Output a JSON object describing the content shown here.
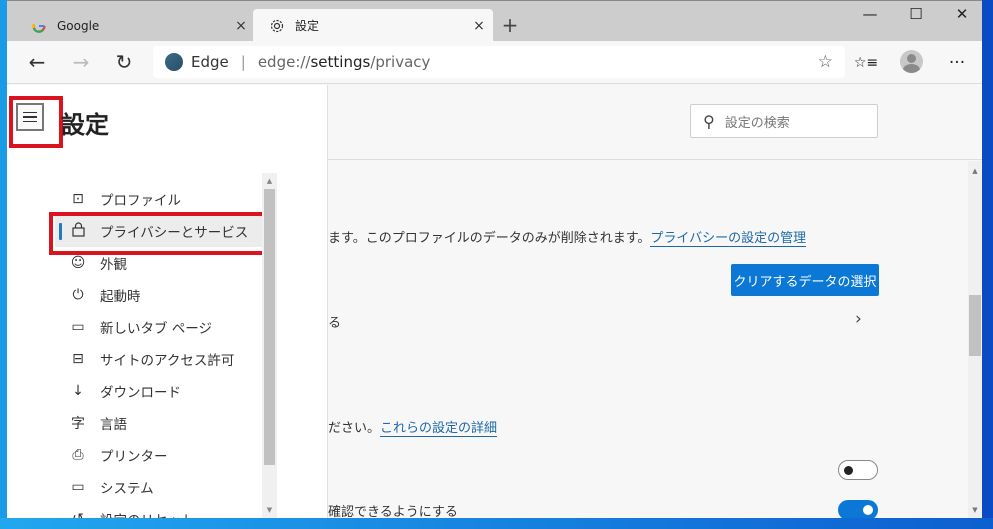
{
  "tabs": [
    {
      "title": "Google",
      "icon": "google-icon",
      "close": "×"
    },
    {
      "title": "設定",
      "icon": "gear-icon",
      "close": "×"
    }
  ],
  "new_tab": "+",
  "window_controls": {
    "minimize": "—",
    "maximize": "☐",
    "close": "✕"
  },
  "toolbar": {
    "back": "←",
    "forward": "→",
    "refresh": "↻",
    "address_brand": "Edge",
    "address_separator": "|",
    "url_prefix": "edge://",
    "url_host": "settings",
    "url_path": "/privacy",
    "favorite_star": "☆",
    "favorites": "☆≡",
    "more": "···"
  },
  "sidebar": {
    "title": "設定",
    "items": [
      {
        "label": "プロファイル",
        "icon": "⊡",
        "icon_name": "profile-icon"
      },
      {
        "label": "プライバシーとサービス",
        "icon": "🔒︎",
        "icon_name": "lock-icon",
        "selected": true
      },
      {
        "label": "外観",
        "icon": "☺",
        "icon_name": "palette-icon"
      },
      {
        "label": "起動時",
        "icon": "⏻",
        "icon_name": "power-icon"
      },
      {
        "label": "新しいタブ ページ",
        "icon": "▭",
        "icon_name": "new-tab-page-icon"
      },
      {
        "label": "サイトのアクセス許可",
        "icon": "⊟",
        "icon_name": "site-permissions-icon"
      },
      {
        "label": "ダウンロード",
        "icon": "↓",
        "icon_name": "download-icon"
      },
      {
        "label": "言語",
        "icon": "字",
        "icon_name": "language-icon"
      },
      {
        "label": "プリンター",
        "icon": "⎙",
        "icon_name": "printer-icon"
      },
      {
        "label": "システム",
        "icon": "▭",
        "icon_name": "laptop-icon"
      },
      {
        "label": "設定のリセット",
        "icon": "↺",
        "icon_name": "reset-icon"
      }
    ]
  },
  "search": {
    "placeholder": "設定の検索",
    "icon": "⚲"
  },
  "content": {
    "clear_data_text": "ます。このプロファイルのデータのみが削除されます。",
    "clear_data_link": "プライバシーの設定の管理",
    "clear_button": "クリアするデータの選択",
    "row_text": "る",
    "chevron": "›",
    "privacy_text": "ださい。",
    "privacy_link": "これらの設定の詳細",
    "toggle1": {
      "state": "off"
    },
    "toggle2_text": "確認できるようにする",
    "toggle2": {
      "state": "on"
    }
  },
  "colors": {
    "accent": "#0a78d4",
    "highlight_box": "#d9141e",
    "link": "#1e68a8"
  }
}
